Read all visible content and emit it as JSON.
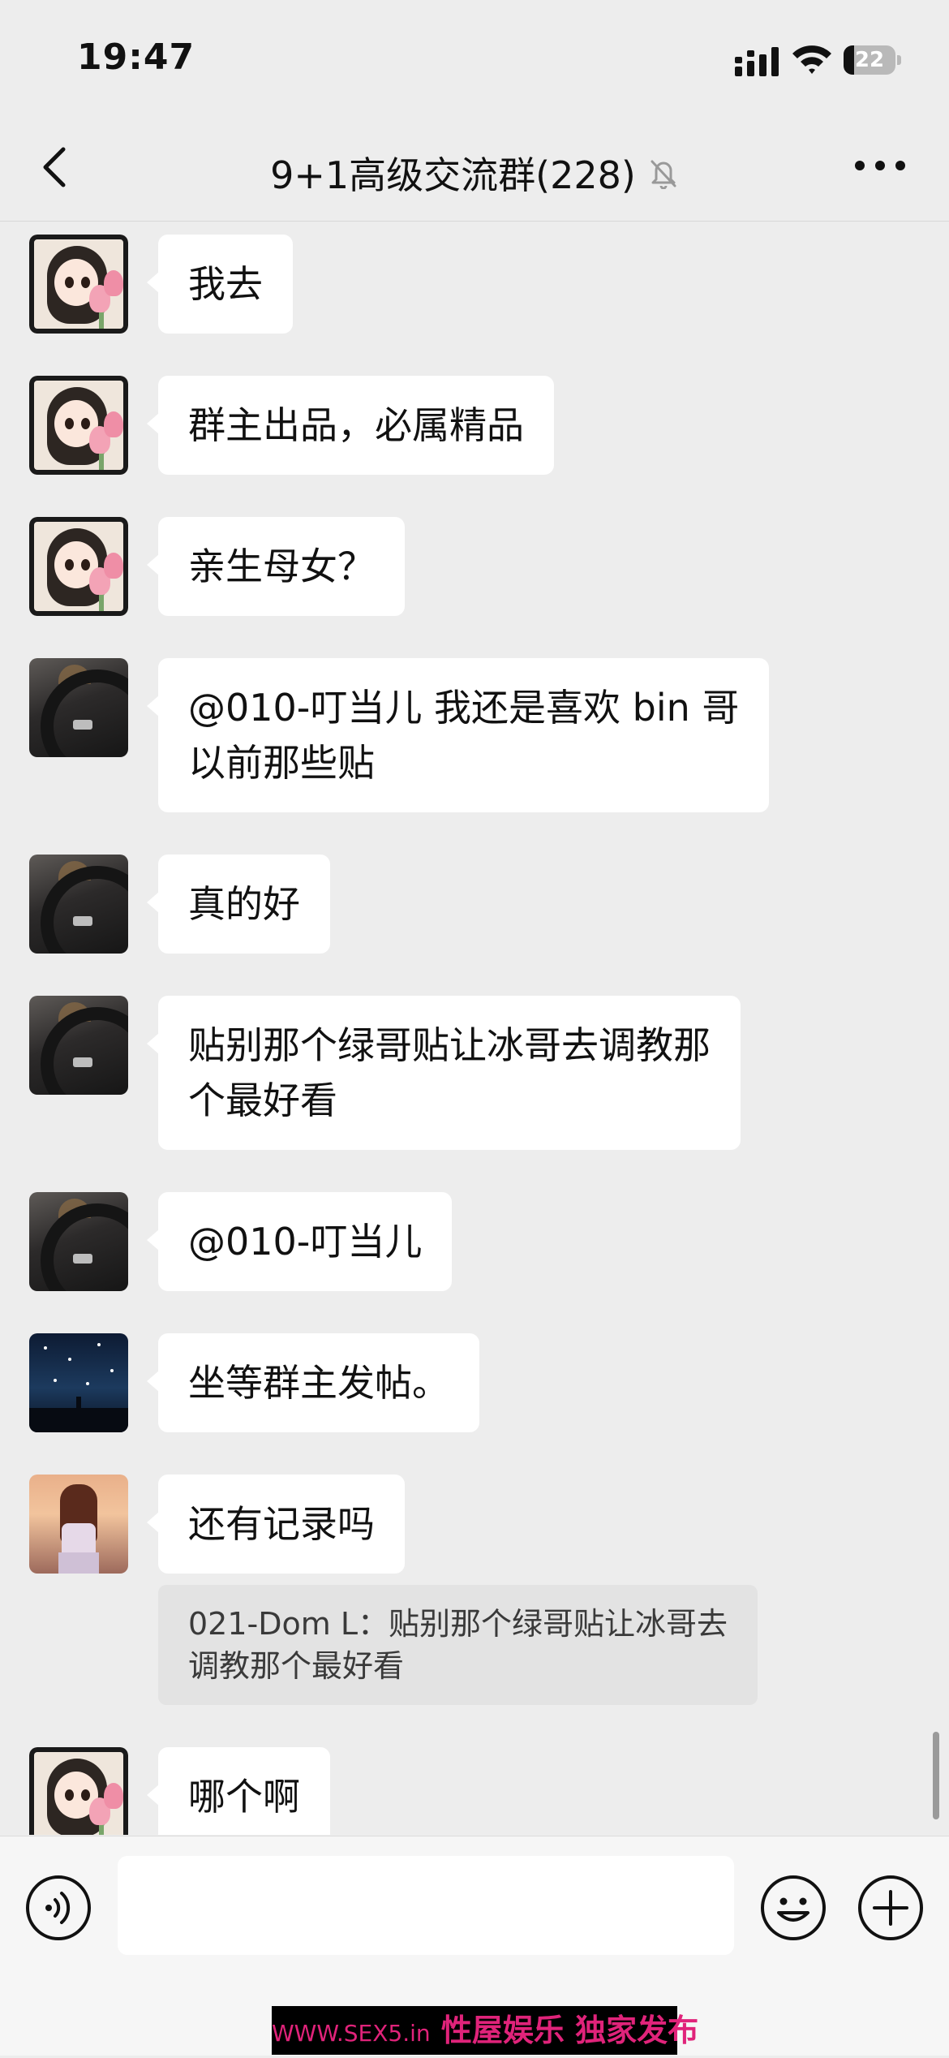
{
  "status_bar": {
    "time": "19:47",
    "battery": "22"
  },
  "header": {
    "title": "9+1高级交流群(228)",
    "back_icon": "chevron-left-icon",
    "mute_icon": "bell-slash-icon",
    "more_icon": "ellipsis-icon"
  },
  "messages": [
    {
      "avatar": "girl-tulip",
      "text": "我去"
    },
    {
      "avatar": "girl-tulip",
      "text": "群主出品，必属精品"
    },
    {
      "avatar": "girl-tulip",
      "text": "亲生母女？"
    },
    {
      "avatar": "car-steering-wheel",
      "line1": "@010-叮当儿 我还是喜欢 bin 哥",
      "line2": "以前那些贴"
    },
    {
      "avatar": "car-steering-wheel",
      "text": "真的好"
    },
    {
      "avatar": "car-steering-wheel",
      "line1": "贴别那个绿哥贴让冰哥去调教那",
      "line2": "个最好看"
    },
    {
      "avatar": "car-steering-wheel",
      "text": "@010-叮当儿"
    },
    {
      "avatar": "night-sky",
      "text": "坐等群主发帖。"
    },
    {
      "avatar": "sunset-girl",
      "text": "还有记录吗",
      "quote_line1": "021-Dom L：贴别那个绿哥贴让冰哥去",
      "quote_line2": "调教那个最好看"
    },
    {
      "avatar": "girl-tulip",
      "text": "哪个啊"
    }
  ],
  "input_bar": {
    "voice_icon": "voice-icon",
    "emoji_icon": "emoji-icon",
    "plus_icon": "plus-icon",
    "input_value": ""
  },
  "watermark": {
    "site": "WWW.SEX5.in",
    "text": "性屋娱乐 独家发布"
  },
  "colors": {
    "background": "#ededed",
    "bubble": "#ffffff",
    "quote": "#e3e3e3",
    "watermark": "#e0237a"
  }
}
